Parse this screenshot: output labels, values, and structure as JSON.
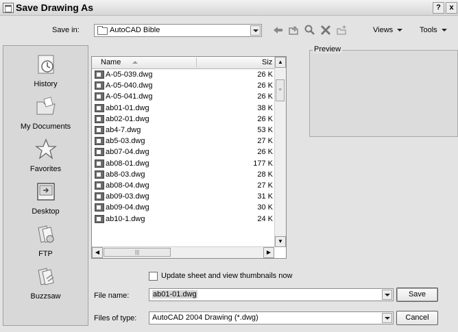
{
  "window": {
    "title": "Save Drawing As",
    "help_btn": "?",
    "close_btn": "x"
  },
  "toolbar": {
    "save_in_label": "Save in:",
    "save_in_value": "AutoCAD Bible",
    "views_label": "Views",
    "tools_label": "Tools",
    "icons": [
      "back-arrow-icon",
      "up-folder-icon",
      "search-web-icon",
      "delete-icon",
      "create-folder-icon"
    ]
  },
  "places": [
    {
      "label": "History",
      "icon": "history-icon"
    },
    {
      "label": "My Documents",
      "icon": "my-documents-icon"
    },
    {
      "label": "Favorites",
      "icon": "favorites-icon"
    },
    {
      "label": "Desktop",
      "icon": "desktop-icon"
    },
    {
      "label": "FTP",
      "icon": "ftp-icon"
    },
    {
      "label": "Buzzsaw",
      "icon": "buzzsaw-icon"
    }
  ],
  "file_list": {
    "columns": {
      "name": "Name",
      "size": "Siz"
    },
    "files": [
      {
        "name": "A-05-039.dwg",
        "size": "26 K"
      },
      {
        "name": "A-05-040.dwg",
        "size": "26 K"
      },
      {
        "name": "A-05-041.dwg",
        "size": "26 K"
      },
      {
        "name": "ab01-01.dwg",
        "size": "38 K"
      },
      {
        "name": "ab02-01.dwg",
        "size": "26 K"
      },
      {
        "name": "ab4-7.dwg",
        "size": "53 K"
      },
      {
        "name": "ab5-03.dwg",
        "size": "27 K"
      },
      {
        "name": "ab07-04.dwg",
        "size": "26 K"
      },
      {
        "name": "ab08-01.dwg",
        "size": "177 K"
      },
      {
        "name": "ab8-03.dwg",
        "size": "28 K"
      },
      {
        "name": "ab08-04.dwg",
        "size": "27 K"
      },
      {
        "name": "ab09-03.dwg",
        "size": "31 K"
      },
      {
        "name": "ab09-04.dwg",
        "size": "30 K"
      },
      {
        "name": "ab10-1.dwg",
        "size": "24 K"
      }
    ]
  },
  "preview": {
    "label": "Preview"
  },
  "options": {
    "update_thumbnails_label": "Update sheet and view thumbnails now",
    "update_thumbnails_checked": false
  },
  "form": {
    "file_name_label": "File name:",
    "file_name_value": "ab01-01.dwg",
    "file_type_label": "Files of type:",
    "file_type_value": "AutoCAD 2004 Drawing (*.dwg)"
  },
  "buttons": {
    "save": "Save",
    "cancel": "Cancel"
  }
}
